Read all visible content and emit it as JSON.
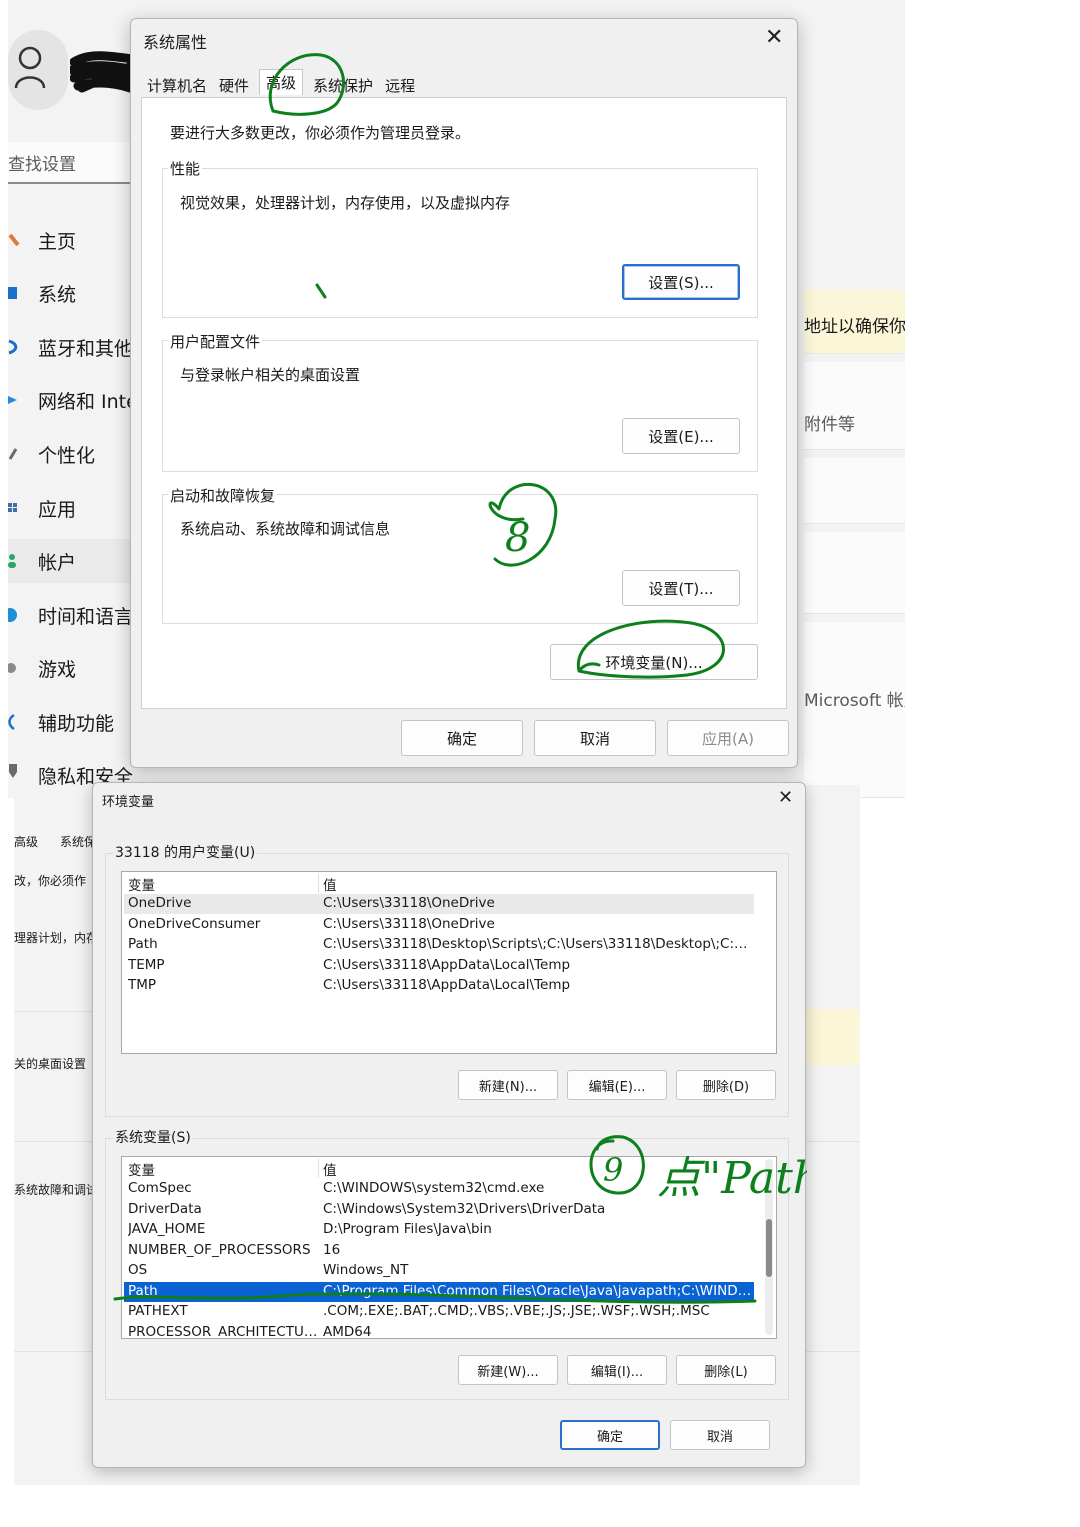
{
  "settings": {
    "search_placeholder": "查找设置",
    "nav": [
      {
        "label": "主页"
      },
      {
        "label": "系统"
      },
      {
        "label": "蓝牙和其他"
      },
      {
        "label": "网络和 Inte"
      },
      {
        "label": "个性化"
      },
      {
        "label": "应用"
      },
      {
        "label": "帐户"
      },
      {
        "label": "时间和语言"
      },
      {
        "label": "游戏"
      },
      {
        "label": "辅助功能"
      },
      {
        "label": "隐私和安全性"
      }
    ],
    "right_cards": [
      "地址以确保你",
      "附件等",
      "Microsoft 帐户"
    ]
  },
  "system_properties": {
    "title": "系统属性",
    "close_label": "✕",
    "tabs": [
      "计算机名",
      "硬件",
      "高级",
      "系统保护",
      "远程"
    ],
    "admin_note": "要进行大多数更改，你必须作为管理员登录。",
    "performance": {
      "title": "性能",
      "desc": "视觉效果，处理器计划，内存使用，以及虚拟内存",
      "button": "设置(S)..."
    },
    "profiles": {
      "title": "用户配置文件",
      "desc": "与登录帐户相关的桌面设置",
      "button": "设置(E)..."
    },
    "startup": {
      "title": "启动和故障恢复",
      "desc": "系统启动、系统故障和调试信息",
      "button": "设置(T)..."
    },
    "env_button": "环境变量(N)...",
    "ok": "确定",
    "cancel": "取消",
    "apply": "应用(A)"
  },
  "env_background": {
    "fragments": [
      "高级",
      "系统保",
      "改，你必须作",
      "理器计划，内存",
      "关的桌面设置",
      "系统故障和调试信"
    ]
  },
  "env_vars": {
    "title": "环境变量",
    "close_label": "✕",
    "user_section_title": "33118 的用户变量(U)",
    "columns": [
      "变量",
      "值"
    ],
    "user_vars": [
      {
        "name": "OneDrive",
        "value": "C:\\Users\\33118\\OneDrive"
      },
      {
        "name": "OneDriveConsumer",
        "value": "C:\\Users\\33118\\OneDrive"
      },
      {
        "name": "Path",
        "value": "C:\\Users\\33118\\Desktop\\Scripts\\;C:\\Users\\33118\\Desktop\\;C:\\User..."
      },
      {
        "name": "TEMP",
        "value": "C:\\Users\\33118\\AppData\\Local\\Temp"
      },
      {
        "name": "TMP",
        "value": "C:\\Users\\33118\\AppData\\Local\\Temp"
      }
    ],
    "user_buttons": [
      "新建(N)...",
      "编辑(E)...",
      "删除(D)"
    ],
    "system_section_title": "系统变量(S)",
    "system_vars": [
      {
        "name": "ComSpec",
        "value": "C:\\WINDOWS\\system32\\cmd.exe"
      },
      {
        "name": "DriverData",
        "value": "C:\\Windows\\System32\\Drivers\\DriverData"
      },
      {
        "name": "JAVA_HOME",
        "value": "D:\\Program Files\\Java\\bin"
      },
      {
        "name": "NUMBER_OF_PROCESSORS",
        "value": "16"
      },
      {
        "name": "OS",
        "value": "Windows_NT"
      },
      {
        "name": "Path",
        "value": "C:\\Program Files\\Common Files\\Oracle\\Java\\javapath;C:\\WINDOW..."
      },
      {
        "name": "PATHEXT",
        "value": ".COM;.EXE;.BAT;.CMD;.VBS;.VBE;.JS;.JSE;.WSF;.WSH;.MSC"
      },
      {
        "name": "PROCESSOR_ARCHITECTURE",
        "value": "AMD64"
      }
    ],
    "system_buttons": [
      "新建(W)...",
      "编辑(I)...",
      "删除(L)"
    ],
    "ok": "确定",
    "cancel": "取消"
  },
  "annotations": {
    "step8": "8",
    "step9": "9",
    "step9_text": "点\"Path\""
  }
}
